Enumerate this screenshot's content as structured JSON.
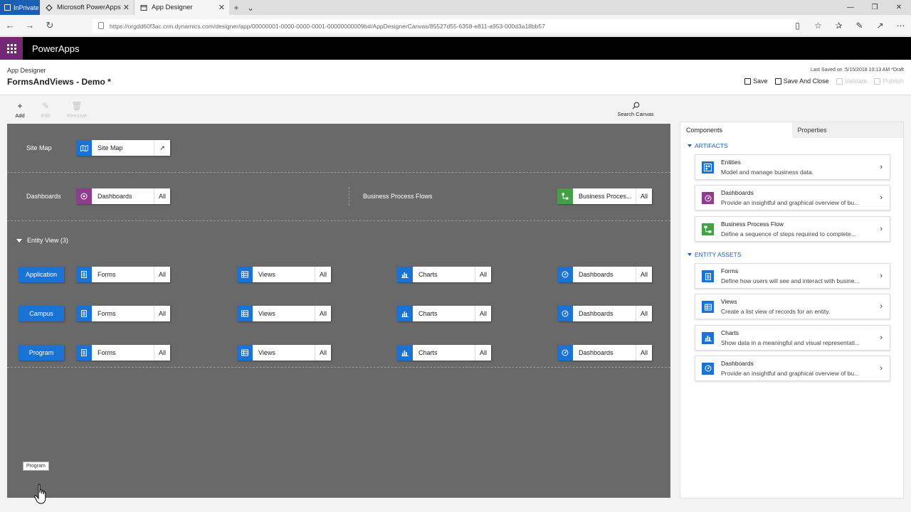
{
  "browser": {
    "inprivate_label": "InPrivate",
    "tabs": [
      {
        "title": "Microsoft PowerApps"
      },
      {
        "title": "App Designer"
      }
    ],
    "url": "https://orgdd60f3ac.crm.dynamics.com/designer/app/00000001-0000-0000-0001-00000000009b#/AppDesignerCanvas/85527d55-6358-e811-a953-000d3a18bb57"
  },
  "app": {
    "brand": "PowerApps",
    "breadcrumb": "App Designer",
    "title": "FormsAndViews - Demo *",
    "last_saved": "Last Saved on :5/15/2018 10:13 AM *Draft",
    "commands": {
      "save": "Save",
      "save_close": "Save And Close",
      "validate": "Validate",
      "publish": "Publish"
    }
  },
  "toolbar": {
    "add": "Add",
    "edit": "Edit",
    "remove": "Remove",
    "search": "Search Canvas"
  },
  "canvas": {
    "sitemap_label": "Site Map",
    "sitemap_tile": "Site Map",
    "dashboards_label": "Dashboards",
    "dashboards_tile": "Dashboards",
    "all": "All",
    "bpf_label": "Business Process Flows",
    "bpf_tile": "Business Proces...",
    "entity_view": "Entity View (3)",
    "entities": [
      {
        "name": "Application"
      },
      {
        "name": "Campus"
      },
      {
        "name": "Program"
      }
    ],
    "forms": "Forms",
    "views": "Views",
    "charts": "Charts",
    "dashboards": "Dashboards",
    "tooltip": "Program"
  },
  "panel": {
    "tab_components": "Components",
    "tab_properties": "Properties",
    "artifacts_title": "ARTIFACTS",
    "artifacts": [
      {
        "name": "Entities",
        "desc": "Model and manage business data.",
        "icon": "entities-icon",
        "color": "#1a73d4"
      },
      {
        "name": "Dashboards",
        "desc": "Provide an insightful and graphical overview of bu...",
        "icon": "dashboard-icon",
        "color": "#8e3c8e"
      },
      {
        "name": "Business Process Flow",
        "desc": "Define a sequence of steps required to complete...",
        "icon": "flow-icon",
        "color": "#43a047"
      }
    ],
    "entity_assets_title": "ENTITY ASSETS",
    "entity_assets": [
      {
        "name": "Forms",
        "desc": "Define how users will see and interact with busine...",
        "icon": "form-icon",
        "color": "#1a73d4"
      },
      {
        "name": "Views",
        "desc": "Create a list view of records for an entity.",
        "icon": "view-icon",
        "color": "#1a73d4"
      },
      {
        "name": "Charts",
        "desc": "Show data in a meaningful and visual representati...",
        "icon": "chart-icon",
        "color": "#1a73d4"
      },
      {
        "name": "Dashboards",
        "desc": "Provide an insightful and graphical overview of bu...",
        "icon": "dashboard-icon",
        "color": "#1a73d4"
      }
    ]
  }
}
